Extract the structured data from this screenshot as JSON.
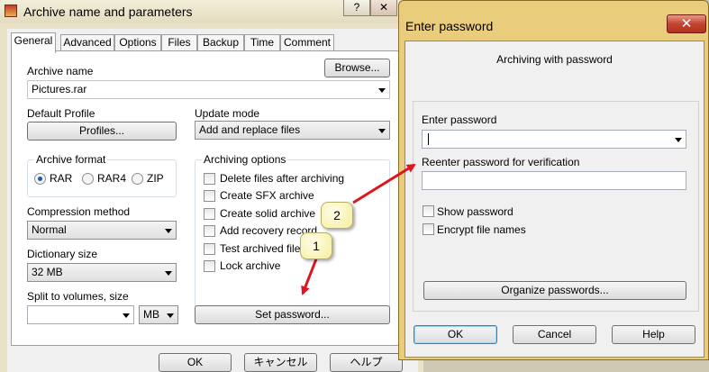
{
  "main_window": {
    "title": "Archive name and parameters",
    "help_btn": "?",
    "close_btn": "✕",
    "tabs": [
      "General",
      "Advanced",
      "Options",
      "Files",
      "Backup",
      "Time",
      "Comment"
    ],
    "archive_name_label": "Archive name",
    "browse_label": "Browse...",
    "archive_name_value": "Pictures.rar",
    "default_profile_label": "Default Profile",
    "profiles_label": "Profiles...",
    "update_mode_label": "Update mode",
    "update_mode_value": "Add and replace files",
    "archive_format_label": "Archive format",
    "formats": [
      "RAR",
      "RAR4",
      "ZIP"
    ],
    "selected_format": "RAR",
    "archiving_options_label": "Archiving options",
    "options": [
      "Delete files after archiving",
      "Create SFX archive",
      "Create solid archive",
      "Add recovery record",
      "Test archived files",
      "Lock archive"
    ],
    "compression_method_label": "Compression method",
    "compression_method_value": "Normal",
    "dictionary_size_label": "Dictionary size",
    "dictionary_size_value": "32 MB",
    "split_label": "Split to volumes, size",
    "split_value": "",
    "split_unit": "MB",
    "set_password_label": "Set password...",
    "ok_label": "OK",
    "cancel_label": "キャンセル",
    "help_label": "ヘルプ"
  },
  "password_dialog": {
    "title": "Enter password",
    "close_btn": "✕",
    "header": "Archiving with password",
    "enter_password_label": "Enter password",
    "password_value": "",
    "reenter_label": "Reenter password for verification",
    "show_password_label": "Show password",
    "encrypt_names_label": "Encrypt file names",
    "organize_label": "Organize passwords...",
    "ok_label": "OK",
    "cancel_label": "Cancel",
    "help_label": "Help"
  },
  "annotations": [
    "1",
    "2"
  ],
  "colors": {
    "arrow": "#e0141e",
    "dialog_frame": "#e9cc7c",
    "close_button": "#c24531"
  }
}
